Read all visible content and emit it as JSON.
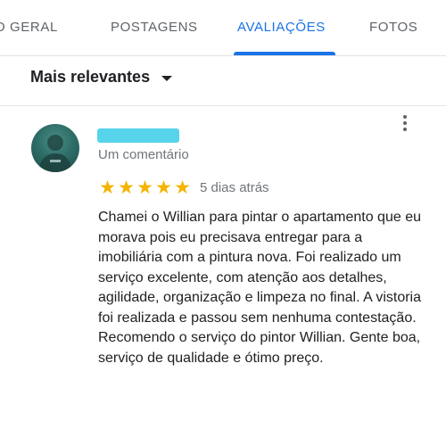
{
  "tabs": [
    {
      "label": "O GERAL"
    },
    {
      "label": "POSTAGENS"
    },
    {
      "label": "AVALIAÇÕES"
    },
    {
      "label": "FOTOS"
    }
  ],
  "active_tab": "AVALIAÇÕES",
  "sort": {
    "label": "Mais relevantes"
  },
  "review": {
    "comment_count": "Um comentário",
    "rating": 5,
    "max_rating": 5,
    "time": "5 dias atrás",
    "text": "Chamei o Willian para pintar o apartamento que eu morava pois eu precisava entregar para a imobiliária com a pintura nova. Foi realizado um serviço excelente, com atenção aos detalhes, agilidade, organização e limpeza no final. A vistoria foi realizada e passou sem nenhuma contestação. Recomendo o serviço do pintor Willian. Gente boa, serviço de qualidade e ótimo preço."
  },
  "colors": {
    "accent": "#1a73e8",
    "star": "#f4b400",
    "redaction": "#57d3ec"
  },
  "icons": {
    "sort": "caret-down-icon",
    "menu": "more-vert-icon",
    "star": "star-icon"
  }
}
